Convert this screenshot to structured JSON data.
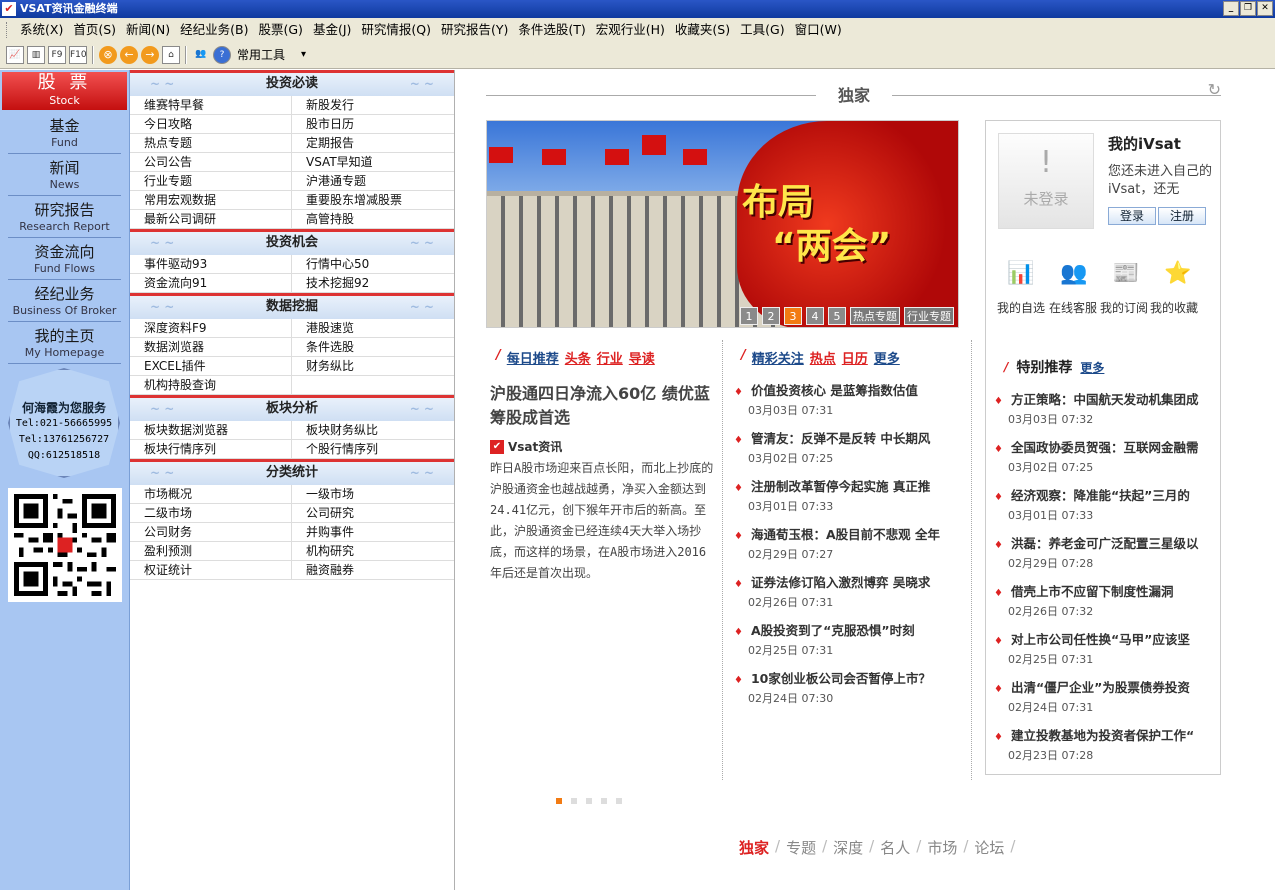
{
  "window": {
    "title": "VSAT资讯金融终端"
  },
  "menu": [
    "系统(X)",
    "首页(S)",
    "新闻(N)",
    "经纪业务(B)",
    "股票(G)",
    "基金(J)",
    "研究情报(Q)",
    "研究报告(Y)",
    "条件选股(T)",
    "宏观行业(H)",
    "收藏夹(S)",
    "工具(G)",
    "窗口(W)"
  ],
  "toolbar": {
    "combo": "常用工具"
  },
  "nav": {
    "stock": {
      "zh": "股 票",
      "en": "Stock"
    },
    "items": [
      {
        "zh": "基金",
        "en": "Fund"
      },
      {
        "zh": "新闻",
        "en": "News"
      },
      {
        "zh": "研究报告",
        "en": "Research Report"
      },
      {
        "zh": "资金流向",
        "en": "Fund Flows"
      },
      {
        "zh": "经纪业务",
        "en": "Business Of Broker"
      },
      {
        "zh": "我的主页",
        "en": "My Homepage"
      }
    ],
    "service": {
      "title": "何海霞为您服务",
      "tel1": "Tel:021-56665995",
      "tel2": "Tel:13761256727",
      "qq": "QQ:612518518"
    }
  },
  "categories": [
    {
      "title": "投资必读",
      "links": [
        "维赛特早餐",
        "新股发行",
        "今日攻略",
        "股市日历",
        "热点专题",
        "定期报告",
        "公司公告",
        "VSAT早知道",
        "行业专题",
        "沪港通专题",
        "常用宏观数据",
        "重要股东增减股票",
        "最新公司调研",
        "高管持股"
      ]
    },
    {
      "title": "投资机会",
      "links": [
        "事件驱动93",
        "行情中心50",
        "资金流向91",
        "技术挖掘92"
      ]
    },
    {
      "title": "数据挖掘",
      "links": [
        "深度资料F9",
        "港股速览",
        "数据浏览器",
        "条件选股",
        "EXCEL插件",
        "财务纵比",
        "机构持股查询",
        ""
      ]
    },
    {
      "title": "板块分析",
      "links": [
        "板块数据浏览器",
        "板块财务纵比",
        "板块行情序列",
        "个股行情序列"
      ]
    },
    {
      "title": "分类统计",
      "links": [
        "市场概况",
        "一级市场",
        "二级市场",
        "公司研究",
        "公司财务",
        "并购事件",
        "盈利预测",
        "机构研究",
        "权证统计",
        "融资融券"
      ]
    }
  ],
  "main": {
    "header": "独家",
    "banner": {
      "text1": "布局",
      "text2": "“两会”",
      "nums": [
        "1",
        "2",
        "3",
        "4",
        "5"
      ],
      "active": "3",
      "tag1": "热点专题",
      "tag2": "行业专题"
    },
    "col1": {
      "tabs": [
        "每日推荐",
        "头条",
        "行业",
        "导读"
      ],
      "feature": {
        "title": "沪股通四日净流入60亿 绩优蓝筹股成首选",
        "source": "Vsat资讯",
        "body": "昨日A股市场迎来百点长阳，而北上抄底的沪股通资金也越战越勇，净买入金额达到24.41亿元，创下猴年开市后的新高。至此，沪股通资金已经连续4天大举入场抄底，而这样的场景，在A股市场进入2016年后还是首次出现。"
      }
    },
    "col2": {
      "tabs": [
        "精彩关注",
        "热点",
        "日历",
        "更多"
      ],
      "news": [
        {
          "title": "价值投资核心 是蓝筹指数估值",
          "date": "03月03日 07:31"
        },
        {
          "title": "管清友：反弹不是反转 中长期风",
          "date": "03月02日 07:25"
        },
        {
          "title": "注册制改革暂停今起实施 真正推",
          "date": "03月01日 07:33"
        },
        {
          "title": "海通荀玉根：A股目前不悲观 全年",
          "date": "02月29日 07:27"
        },
        {
          "title": "证券法修订陷入激烈博弈 吴晓求",
          "date": "02月26日 07:31"
        },
        {
          "title": "A股投资到了“克服恐惧”时刻",
          "date": "02月25日 07:31"
        },
        {
          "title": "10家创业板公司会否暂停上市？",
          "date": "02月24日 07:30"
        }
      ]
    },
    "ivsat": {
      "title": "我的iVsat",
      "prompt": "您还未进入自己的iVsat，还无",
      "notlogged": "未登录",
      "login": "登录",
      "register": "注册",
      "icons": [
        "我的自选",
        "在线客服",
        "我的订阅",
        "我的收藏"
      ],
      "special_title": "特别推荐",
      "special_more": "更多",
      "special": [
        {
          "title": "方正策略：中国航天发动机集团成",
          "date": "03月03日 07:32"
        },
        {
          "title": "全国政协委员贺强：互联网金融需",
          "date": "03月02日 07:25"
        },
        {
          "title": "经济观察：降准能“扶起”三月的",
          "date": "03月01日 07:33"
        },
        {
          "title": "洪磊：养老金可广泛配置三星级以",
          "date": "02月29日 07:28"
        },
        {
          "title": "借壳上市不应留下制度性漏洞",
          "date": "02月26日 07:32"
        },
        {
          "title": "对上市公司任性换“马甲”应该坚",
          "date": "02月25日 07:31"
        },
        {
          "title": "出清“僵尸企业”为股票债券投资",
          "date": "02月24日 07:31"
        },
        {
          "title": "建立投教基地为投资者保护工作“",
          "date": "02月23日 07:28"
        }
      ]
    },
    "bottom_tabs": [
      "独家",
      "专题",
      "深度",
      "名人",
      "市场",
      "论坛"
    ]
  }
}
